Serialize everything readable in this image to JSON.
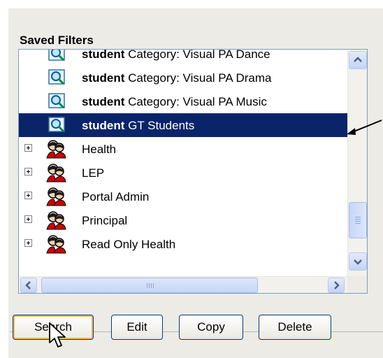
{
  "panel": {
    "title": "Saved Filters"
  },
  "list": {
    "filters": [
      {
        "owner": "student",
        "name": "Category: Visual PA Dance",
        "selected": false
      },
      {
        "owner": "student",
        "name": "Category: Visual PA Drama",
        "selected": false
      },
      {
        "owner": "student",
        "name": "Category: Visual PA Music",
        "selected": false
      },
      {
        "owner": "student",
        "name": "GT Students",
        "selected": true
      }
    ],
    "groups": [
      {
        "name": "Health"
      },
      {
        "name": "LEP"
      },
      {
        "name": "Portal Admin"
      },
      {
        "name": "Principal"
      },
      {
        "name": "Read Only Health"
      }
    ],
    "selection_color": "#0a246a"
  },
  "scrollbars": {
    "vertical_position": 0.72,
    "horizontal_position": 0
  },
  "buttons": {
    "search_label": "Search",
    "edit_label": "Edit",
    "copy_label": "Copy",
    "delete_label": "Delete"
  },
  "icons": {
    "filter": "magnifier-icon",
    "group": "people-group-icon",
    "expander": "plus-expander-icon",
    "cursor": "mouse-pointer-icon",
    "annotation": "arrow-pointer-icon"
  }
}
